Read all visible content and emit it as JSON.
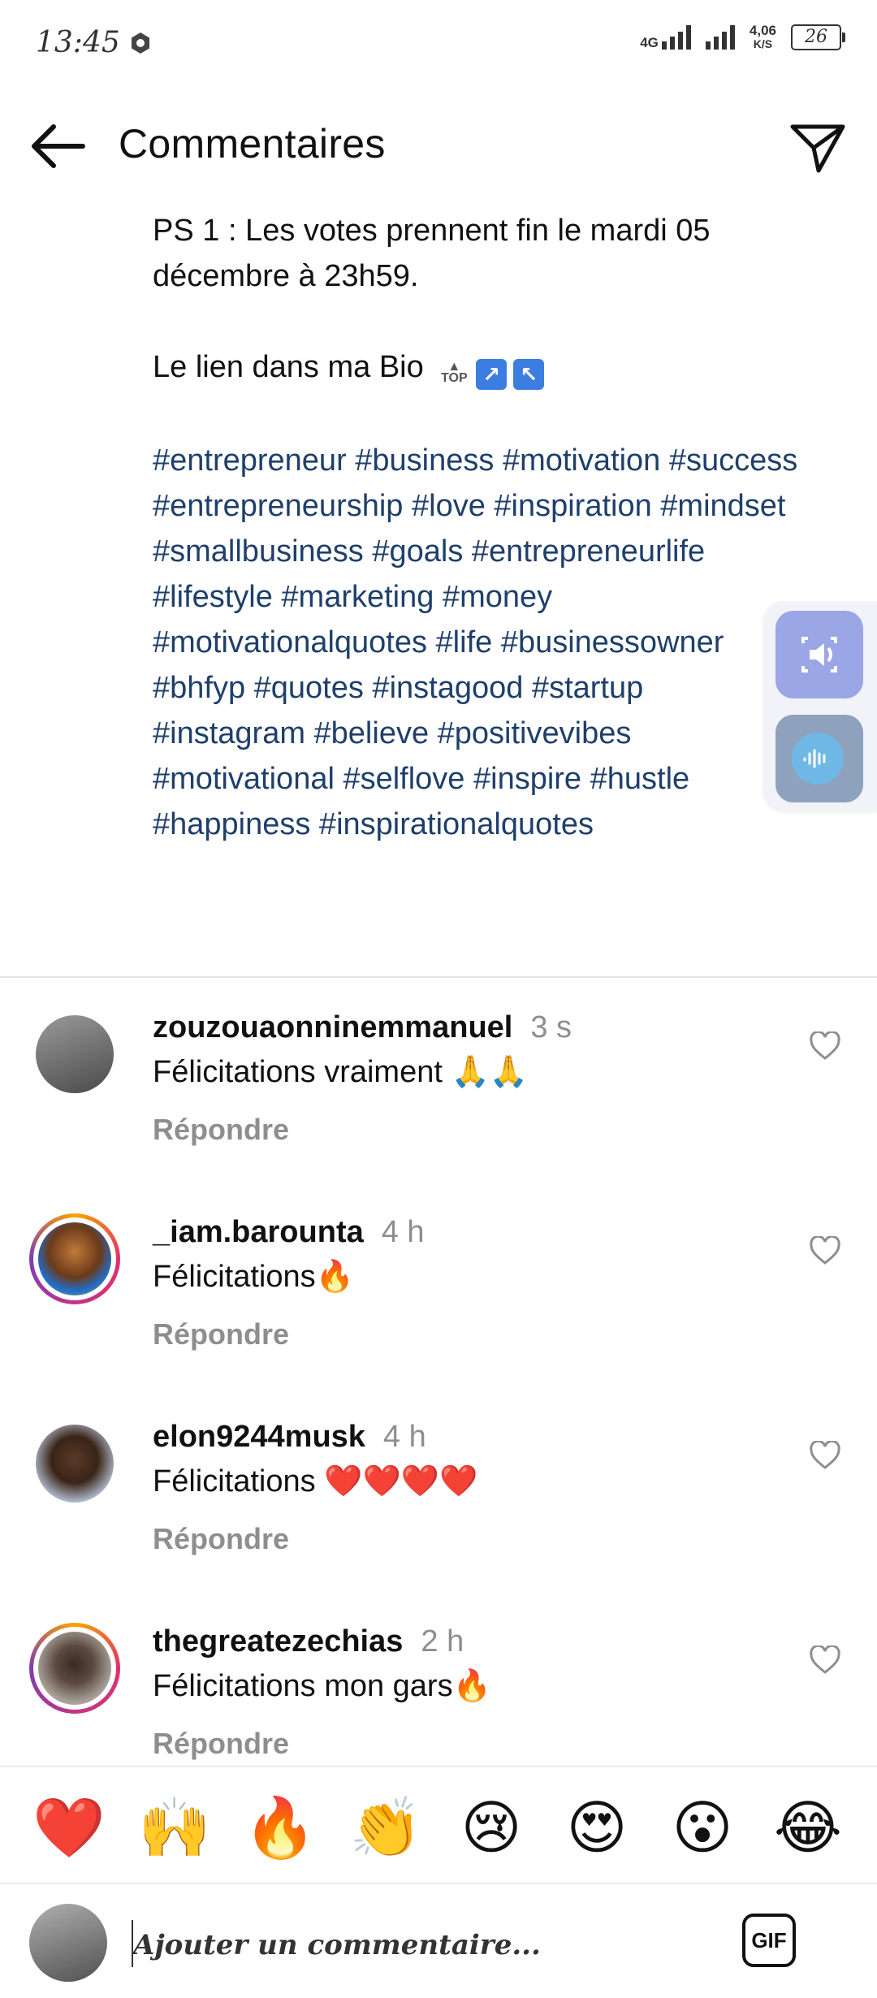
{
  "status": {
    "time": "13:45",
    "network_top": "4G",
    "speed_value": "4,06",
    "speed_unit": "K/S",
    "battery": "26"
  },
  "header": {
    "title": "Commentaires"
  },
  "caption": {
    "line1": "PS 1 : Les votes prennent fin le mardi 05 décembre à 23h59.",
    "line2": "Le lien dans ma Bio",
    "hashtags": "#entrepreneur #business #motivation #success #entrepreneurship #love #inspiration #mindset #smallbusiness #goals #entrepreneurlife #lifestyle #marketing #money #motivationalquotes #life #businessowner #bhfyp #quotes #instagood #startup #instagram #believe #positivevibes #motivational #selflove #inspire #hustle #happiness #inspirationalquotes"
  },
  "comments": [
    {
      "username": "zouzouaonninemmanuel",
      "time": "3 s",
      "text": "Félicitations vraiment 🙏🙏",
      "reply": "Répondre",
      "story_ring": false
    },
    {
      "username": "_iam.barounta",
      "time": "4 h",
      "text": "Félicitations🔥",
      "reply": "Répondre",
      "story_ring": true
    },
    {
      "username": "elon9244musk",
      "time": "4 h",
      "text": "Félicitations ❤️❤️❤️❤️",
      "reply": "Répondre",
      "story_ring": false
    },
    {
      "username": "thegreatezechias",
      "time": "2 h",
      "text": "Félicitations mon gars🔥",
      "reply": "Répondre",
      "story_ring": true
    }
  ],
  "emoji_bar": [
    "❤️",
    "🙌",
    "🔥",
    "👏",
    "😢",
    "😍",
    "😮",
    "😂"
  ],
  "composer": {
    "placeholder": "Ajouter un commentaire...",
    "gif_label": "GIF"
  },
  "colors": {
    "hashtag": "#1f3f6b",
    "muted": "#8e8e8e"
  }
}
